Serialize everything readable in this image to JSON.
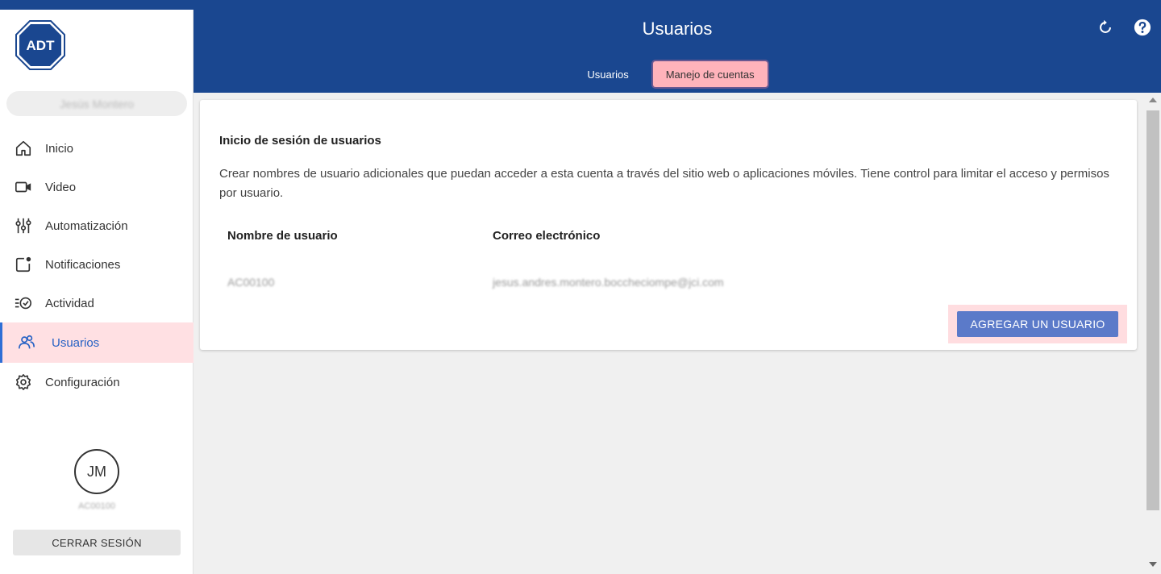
{
  "colors": {
    "brand_blue": "#1a4790",
    "active_highlight": "#ffe0e3",
    "active_tab": "#ffb3bb",
    "primary_button": "#5b7ac9",
    "active_nav_text": "#2561c4"
  },
  "logo": {
    "text": "ADT",
    "icon": "adt-logo"
  },
  "sidebar": {
    "user_name": "Jesús Montero",
    "items": [
      {
        "label": "Inicio",
        "icon": "home-icon"
      },
      {
        "label": "Video",
        "icon": "video-camera-icon"
      },
      {
        "label": "Automatización",
        "icon": "sliders-icon"
      },
      {
        "label": "Notificaciones",
        "icon": "notification-icon"
      },
      {
        "label": "Actividad",
        "icon": "activity-icon"
      },
      {
        "label": "Usuarios",
        "icon": "users-icon",
        "active": true
      },
      {
        "label": "Configuración",
        "icon": "gear-icon"
      }
    ],
    "avatar_initials": "JM",
    "account_id": "AC00100",
    "logout_label": "CERRAR SESIÓN"
  },
  "header": {
    "title": "Usuarios",
    "tabs": [
      {
        "label": "Usuarios",
        "active": false
      },
      {
        "label": "Manejo de cuentas",
        "active": true
      }
    ]
  },
  "card": {
    "title": "Inicio de sesión de usuarios",
    "description": "Crear nombres de usuario adicionales que puedan acceder a esta cuenta a través del sitio web o aplicaciones móviles. Tiene control para limitar el acceso y permisos por usuario.",
    "columns": [
      "Nombre de usuario",
      "Correo electrónico"
    ],
    "rows": [
      {
        "username": "AC00100",
        "email": "jesus.andres.montero.boccheciompe@jci.com"
      }
    ],
    "add_button_label": "AGREGAR UN USUARIO"
  }
}
